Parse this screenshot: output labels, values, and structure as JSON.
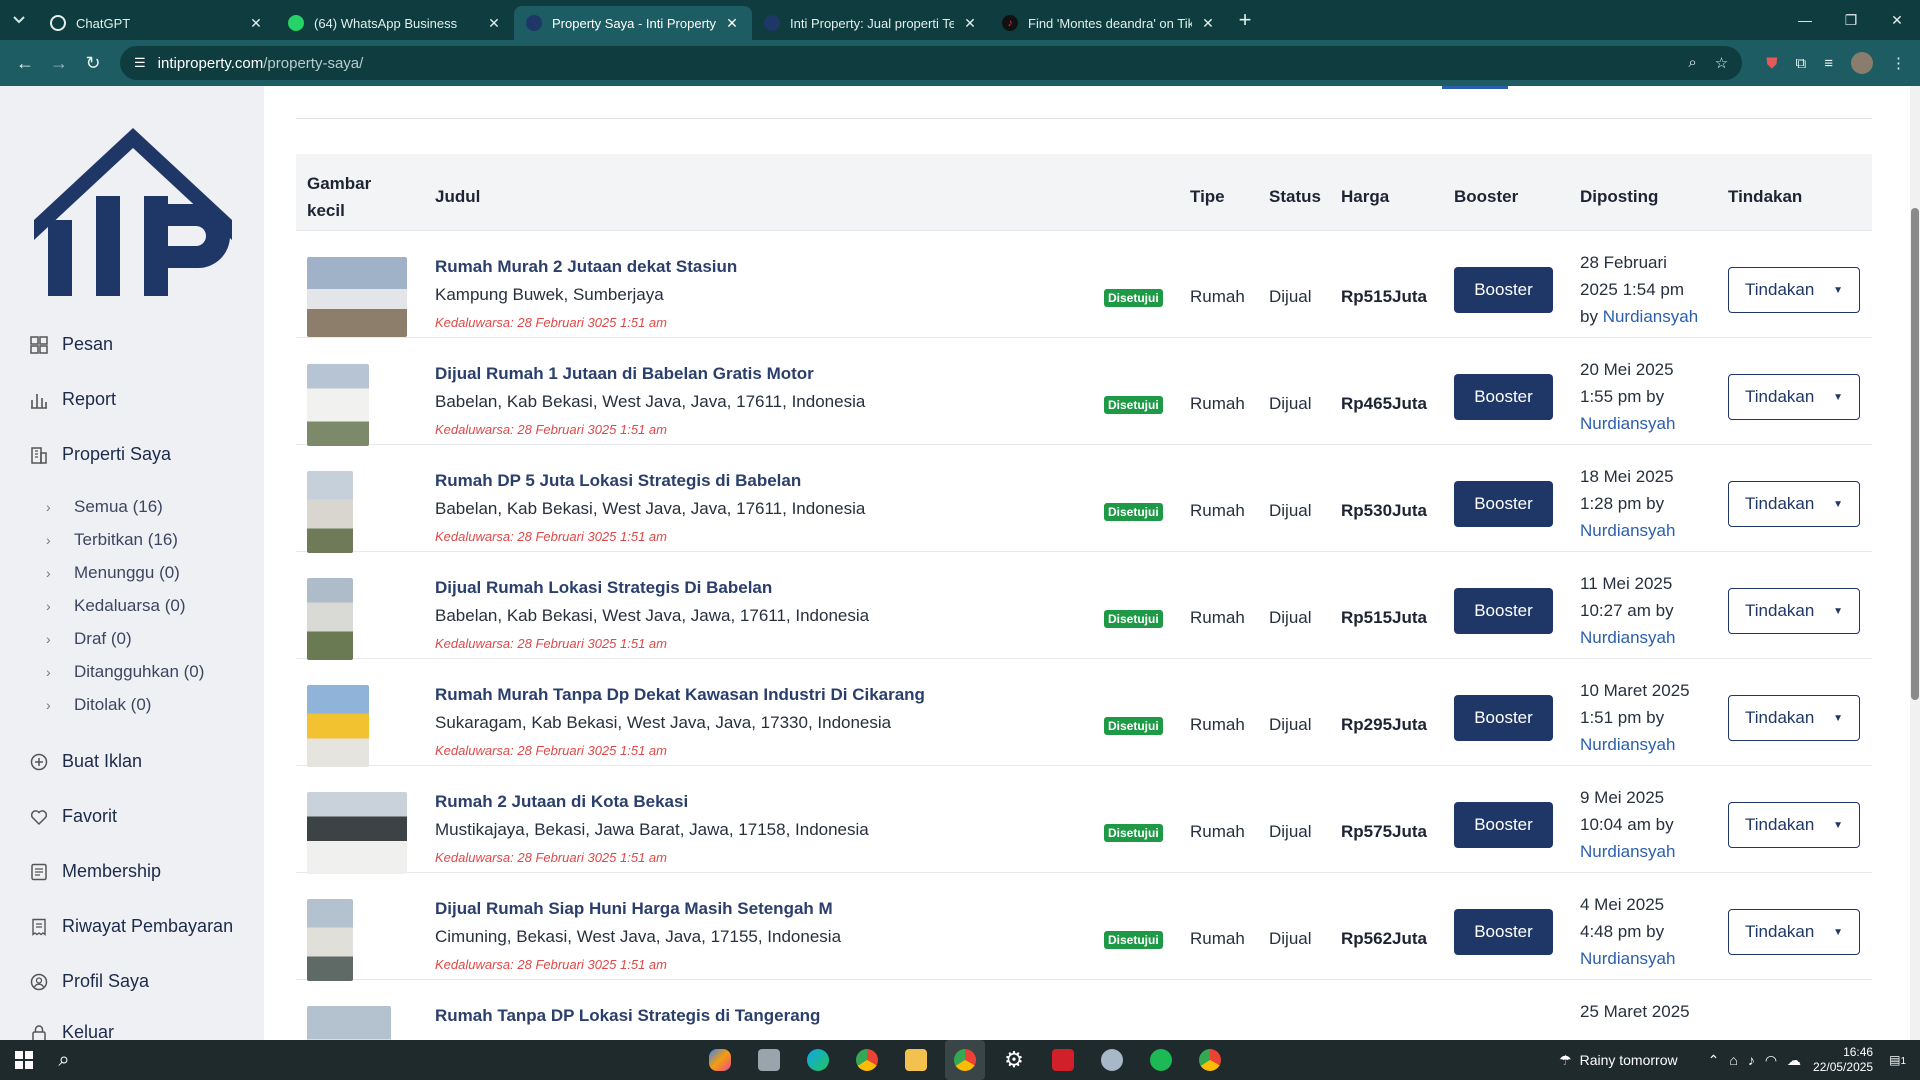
{
  "browser": {
    "tabs": [
      {
        "title": "ChatGPT",
        "active": false,
        "icon": "chatgpt-icon"
      },
      {
        "title": "(64) WhatsApp Business",
        "active": false,
        "icon": "whatsapp-icon"
      },
      {
        "title": "Property Saya - Inti Property",
        "active": true,
        "icon": "site-icon"
      },
      {
        "title": "Inti Property: Jual properti Terle",
        "active": false,
        "icon": "site-icon"
      },
      {
        "title": "Find 'Montes deandra' on TikTo",
        "active": false,
        "icon": "tiktok-icon"
      }
    ],
    "url_host": "intiproperty.com",
    "url_path": "/property-saya/"
  },
  "sidebar": {
    "logo_text": "IP",
    "items": [
      {
        "label": "Pesan",
        "icon": "chat-grid-icon"
      },
      {
        "label": "Report",
        "icon": "bar-chart-icon"
      },
      {
        "label": "Properti Saya",
        "icon": "building-icon"
      }
    ],
    "sub_items": [
      {
        "label": "Semua (16)"
      },
      {
        "label": "Terbitkan (16)"
      },
      {
        "label": "Menunggu (0)"
      },
      {
        "label": "Kedaluarsa (0)"
      },
      {
        "label": "Draf (0)"
      },
      {
        "label": "Ditangguhkan (0)"
      },
      {
        "label": "Ditolak (0)"
      }
    ],
    "items2": [
      {
        "label": "Buat Iklan",
        "icon": "plus-circle-icon"
      },
      {
        "label": "Favorit",
        "icon": "heart-icon"
      },
      {
        "label": "Membership",
        "icon": "card-icon"
      },
      {
        "label": "Riwayat Pembayaran",
        "icon": "receipt-icon"
      },
      {
        "label": "Profil Saya",
        "icon": "user-circle-icon"
      },
      {
        "label": "Keluar",
        "icon": "lock-icon"
      }
    ]
  },
  "table": {
    "headers": {
      "image": "Gambar kecil",
      "title": "Judul",
      "type": "Tipe",
      "status": "Status",
      "price": "Harga",
      "booster": "Booster",
      "posted": "Diposting",
      "action": "Tindakan"
    },
    "rows": [
      {
        "title": "Rumah Murah 2 Jutaan dekat Stasiun",
        "location": "Kampung Buwek, Sumberjaya",
        "expiry": "Kedaluwarsa: 28 Februari 3025 1:51 am",
        "badge": "Disetujui",
        "type": "Rumah",
        "status": "Dijual",
        "price": "Rp515Juta",
        "booster": "Booster",
        "date": "28 Februari 2025",
        "time": "1:54 pm",
        "by": "by",
        "author": "Nurdiansyah",
        "action": "Tindakan"
      },
      {
        "title": "Dijual Rumah 1 Jutaan di Babelan Gratis Motor",
        "location": "Babelan, Kab Bekasi, West Java, Java, 17611, Indonesia",
        "expiry": "Kedaluwarsa: 28 Februari 3025 1:51 am",
        "badge": "Disetujui",
        "type": "Rumah",
        "status": "Dijual",
        "price": "Rp465Juta",
        "booster": "Booster",
        "date": "20 Mei 2025",
        "time": "1:55 pm",
        "by": "by",
        "author": "Nurdiansyah",
        "action": "Tindakan"
      },
      {
        "title": "Rumah DP 5 Juta Lokasi Strategis di Babelan",
        "location": "Babelan, Kab Bekasi, West Java, Java, 17611, Indonesia",
        "expiry": "Kedaluwarsa: 28 Februari 3025 1:51 am",
        "badge": "Disetujui",
        "type": "Rumah",
        "status": "Dijual",
        "price": "Rp530Juta",
        "booster": "Booster",
        "date": "18 Mei 2025",
        "time": "1:28 pm",
        "by": "by",
        "author": "Nurdiansyah",
        "action": "Tindakan"
      },
      {
        "title": "Dijual Rumah Lokasi Strategis Di Babelan",
        "location": "Babelan, Kab Bekasi, West Java, Jawa, 17611, Indonesia",
        "expiry": "Kedaluwarsa: 28 Februari 3025 1:51 am",
        "badge": "Disetujui",
        "type": "Rumah",
        "status": "Dijual",
        "price": "Rp515Juta",
        "booster": "Booster",
        "date": "11 Mei 2025",
        "time": "10:27 am",
        "by": "by",
        "author": "Nurdiansyah",
        "action": "Tindakan"
      },
      {
        "title": "Rumah Murah Tanpa Dp Dekat Kawasan Industri Di Cikarang",
        "location": "Sukaragam, Kab Bekasi, West Java, Java, 17330, Indonesia",
        "expiry": "Kedaluwarsa: 28 Februari 3025 1:51 am",
        "badge": "Disetujui",
        "type": "Rumah",
        "status": "Dijual",
        "price": "Rp295Juta",
        "booster": "Booster",
        "date": "10 Maret 2025",
        "time": "1:51 pm",
        "by": "by",
        "author": "Nurdiansyah",
        "action": "Tindakan"
      },
      {
        "title": "Rumah 2 Jutaan di Kota Bekasi",
        "location": "Mustikajaya, Bekasi, Jawa Barat, Jawa, 17158, Indonesia",
        "expiry": "Kedaluwarsa: 28 Februari 3025 1:51 am",
        "badge": "Disetujui",
        "type": "Rumah",
        "status": "Dijual",
        "price": "Rp575Juta",
        "booster": "Booster",
        "date": "9 Mei 2025",
        "time": "10:04 am",
        "by": "by",
        "author": "Nurdiansyah",
        "action": "Tindakan"
      },
      {
        "title": "Dijual Rumah Siap Huni Harga Masih Setengah M",
        "location": "Cimuning, Bekasi, West Java, Java, 17155, Indonesia",
        "expiry": "Kedaluwarsa: 28 Februari 3025 1:51 am",
        "badge": "Disetujui",
        "type": "Rumah",
        "status": "Dijual",
        "price": "Rp562Juta",
        "booster": "Booster",
        "date": "4 Mei 2025",
        "time": "4:48 pm",
        "by": "by",
        "author": "Nurdiansyah",
        "action": "Tindakan"
      },
      {
        "title": "Rumah Tanpa DP Lokasi Strategis di Tangerang",
        "location": "",
        "expiry": "",
        "badge": "",
        "type": "",
        "status": "",
        "price": "",
        "booster": "",
        "date": "25 Maret 2025",
        "time": "",
        "by": "",
        "author": "",
        "action": ""
      }
    ]
  },
  "taskbar": {
    "weather": "Rainy tomorrow",
    "time": "16:46",
    "date": "22/05/2025",
    "notification_count": "1"
  },
  "colors": {
    "accent": "#1f3766",
    "link": "#2b5fae",
    "badge": "#1e9a46",
    "expiry": "#e04848",
    "browser_frame": "#0f3d3f",
    "browser_toolbar": "#1c5c62"
  }
}
